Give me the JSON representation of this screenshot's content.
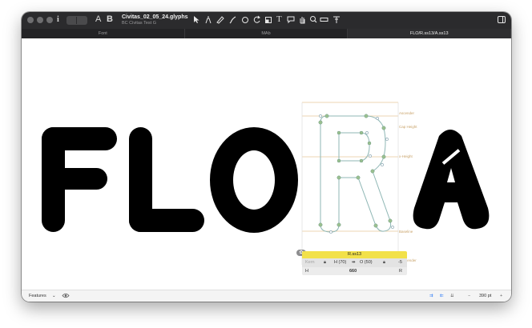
{
  "window": {
    "title": "Civitas_02_05_24.glyphs",
    "subtitle": "BC Civitas Test G"
  },
  "tabs": [
    {
      "label": "Font"
    },
    {
      "label": "MAb"
    },
    {
      "label": "FLO/R.ss13/A.ss13"
    }
  ],
  "toolbar": {
    "info_label": "i",
    "text_tool_label": "A",
    "bold_label": "B",
    "tools": [
      "select-icon",
      "pen-icon",
      "pencil-icon",
      "brush-icon",
      "draw-icon",
      "shape-icon",
      "rotate-icon",
      "scale-icon",
      "text-icon",
      "annotate-icon",
      "hand-icon",
      "zoom-icon",
      "measure-icon",
      "type-icon"
    ]
  },
  "canvas": {
    "letters": [
      "F",
      "L",
      "O",
      "R",
      "A"
    ],
    "metric_labels": {
      "ascender": "Ascender",
      "cap_height": "Cap Height",
      "x_height": "x-Height",
      "baseline": "Baseline",
      "descender": "Descender"
    }
  },
  "glyph_info": {
    "name": "R.ss13",
    "kern_label": "Kern",
    "left_sidebearing": "H (70)",
    "right_sidebearing": "O (50)",
    "right_kern_value": "-5",
    "left_group": "H",
    "width": "660",
    "right_group": "R"
  },
  "bottom": {
    "features_label": "Features",
    "zoom": "390 pt",
    "minus_label": "−",
    "plus_label": "+"
  },
  "colors": {
    "accent_yellow": "#f2e14a",
    "metric_line": "#e9c99a",
    "outline_handle": "#7fb3b0",
    "node_green": "#9bc08f",
    "selection_blue": "#2f7cf6"
  }
}
